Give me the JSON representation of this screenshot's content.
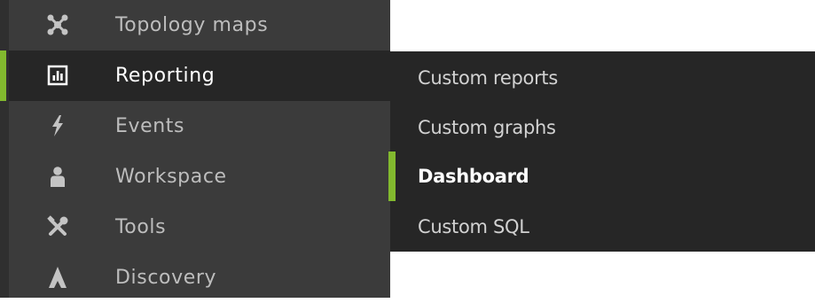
{
  "menu": {
    "items": [
      {
        "label": "Topology maps",
        "icon": "topology-icon"
      },
      {
        "label": "Reporting",
        "icon": "reporting-icon",
        "active": true
      },
      {
        "label": "Events",
        "icon": "lightning-icon"
      },
      {
        "label": "Workspace",
        "icon": "user-icon"
      },
      {
        "label": "Tools",
        "icon": "tools-icon"
      },
      {
        "label": "Discovery",
        "icon": "discovery-icon"
      }
    ]
  },
  "submenu": {
    "items": [
      {
        "label": "Custom reports"
      },
      {
        "label": "Custom graphs"
      },
      {
        "label": "Dashboard",
        "selected": true
      },
      {
        "label": "Custom SQL"
      }
    ]
  },
  "colors": {
    "menu_bg": "#3b3b3b",
    "active_bg": "#262626",
    "accent": "#82b92e",
    "text": "#bdbdbd",
    "active_text": "#ffffff"
  }
}
